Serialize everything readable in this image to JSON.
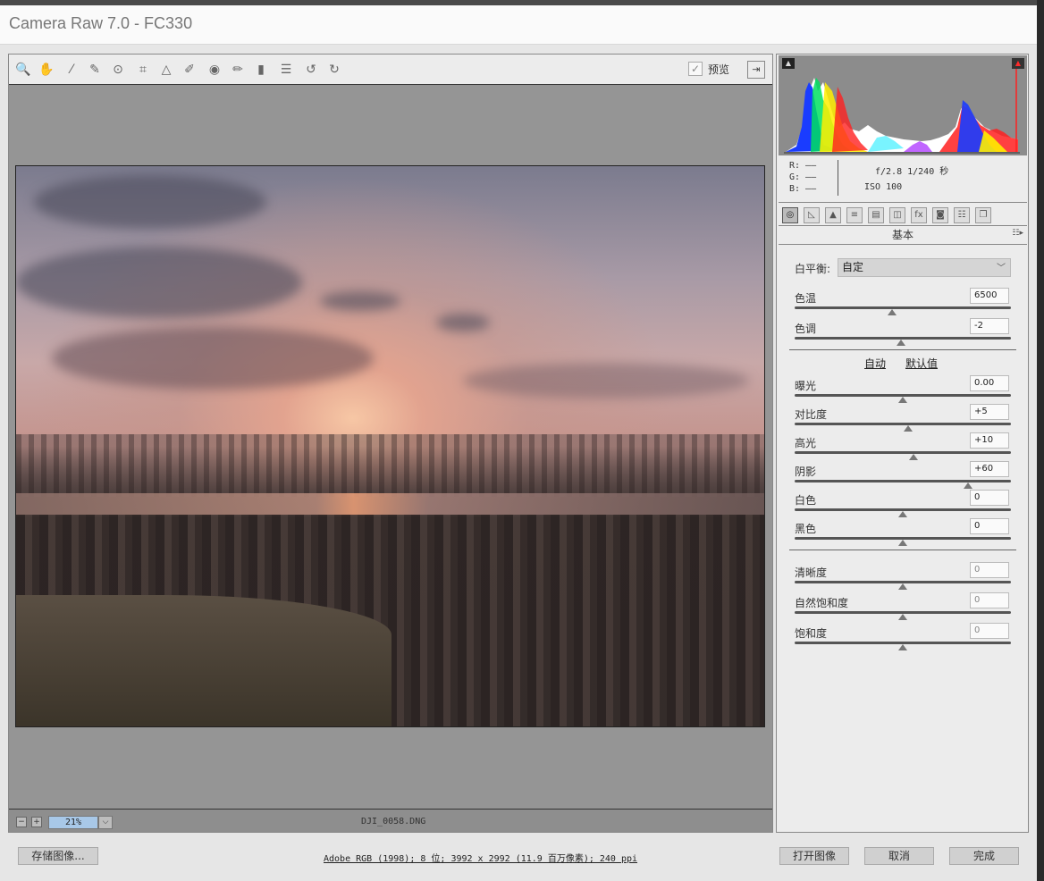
{
  "app": {
    "title": "Camera Raw 7.0 -  FC330"
  },
  "toolbar": {
    "tools": [
      {
        "name": "zoom-icon",
        "glyph": "🔍"
      },
      {
        "name": "hand-icon",
        "glyph": "✋"
      },
      {
        "name": "white-balance-icon",
        "glyph": "⁄"
      },
      {
        "name": "color-sampler-icon",
        "glyph": "✎"
      },
      {
        "name": "targeted-adjustment-icon",
        "glyph": "⊙"
      },
      {
        "name": "crop-icon",
        "glyph": "⌗"
      },
      {
        "name": "straighten-icon",
        "glyph": "△"
      },
      {
        "name": "spot-removal-icon",
        "glyph": "✐"
      },
      {
        "name": "red-eye-icon",
        "glyph": "◉"
      },
      {
        "name": "adjustment-brush-icon",
        "glyph": "✏"
      },
      {
        "name": "graduated-filter-icon",
        "glyph": "▮"
      },
      {
        "name": "preferences-icon",
        "glyph": "☰"
      },
      {
        "name": "rotate-left-icon",
        "glyph": "↺"
      },
      {
        "name": "rotate-right-icon",
        "glyph": "↻"
      }
    ],
    "preview_label": "预览",
    "preview_checked": true
  },
  "status": {
    "zoom": "21%",
    "filename": "DJI_0058.DNG"
  },
  "info": {
    "r": "R: ——",
    "g": "G: ——",
    "b": "B: ——",
    "camera": "f/2.8  1/240 秒",
    "iso": "ISO 100"
  },
  "tabs": [
    {
      "name": "tab-basic-icon",
      "glyph": "◎"
    },
    {
      "name": "tab-tone-curve-icon",
      "glyph": "◺"
    },
    {
      "name": "tab-detail-icon",
      "glyph": "▲"
    },
    {
      "name": "tab-hsl-icon",
      "glyph": "≡"
    },
    {
      "name": "tab-split-toning-icon",
      "glyph": "▤"
    },
    {
      "name": "tab-lens-corrections-icon",
      "glyph": "◫"
    },
    {
      "name": "tab-effects-icon",
      "glyph": "fx"
    },
    {
      "name": "tab-camera-calibration-icon",
      "glyph": "◙"
    },
    {
      "name": "tab-presets-icon",
      "glyph": "☷"
    },
    {
      "name": "tab-snapshots-icon",
      "glyph": "❐"
    }
  ],
  "panel": {
    "header": "基本",
    "menu_icon": "☷▸"
  },
  "white_balance": {
    "label": "白平衡:",
    "value": "自定"
  },
  "sliders_wb": [
    {
      "label": "色温",
      "value": "6500",
      "position": 0.45
    },
    {
      "label": "色调",
      "value": "-2",
      "position": 0.49
    }
  ],
  "links": {
    "auto": "自动",
    "default": "默认值"
  },
  "sliders_tone": [
    {
      "label": "曝光",
      "value": "0.00",
      "position": 0.5
    },
    {
      "label": "对比度",
      "value": "+5",
      "position": 0.525
    },
    {
      "label": "高光",
      "value": "+10",
      "position": 0.55
    },
    {
      "label": "阴影",
      "value": "+60",
      "position": 0.8
    },
    {
      "label": "白色",
      "value": "0",
      "position": 0.5
    },
    {
      "label": "黑色",
      "value": "0",
      "position": 0.5
    }
  ],
  "sliders_presence": [
    {
      "label": "清晰度",
      "value": "0",
      "position": 0.5
    },
    {
      "label": "自然饱和度",
      "value": "0",
      "position": 0.5
    },
    {
      "label": "饱和度",
      "value": "0",
      "position": 0.5
    }
  ],
  "bottom": {
    "save_label": "存储图像...",
    "workflow": "Adobe RGB (1998); 8 位; 3992 x 2992 (11.9 百万像素); 240 ppi",
    "open_label": "打开图像",
    "cancel_label": "取消",
    "done_label": "完成"
  },
  "colors": {
    "accent": "#a8c8e8",
    "panel_bg": "#ececec",
    "canvas_bg": "#959595"
  }
}
